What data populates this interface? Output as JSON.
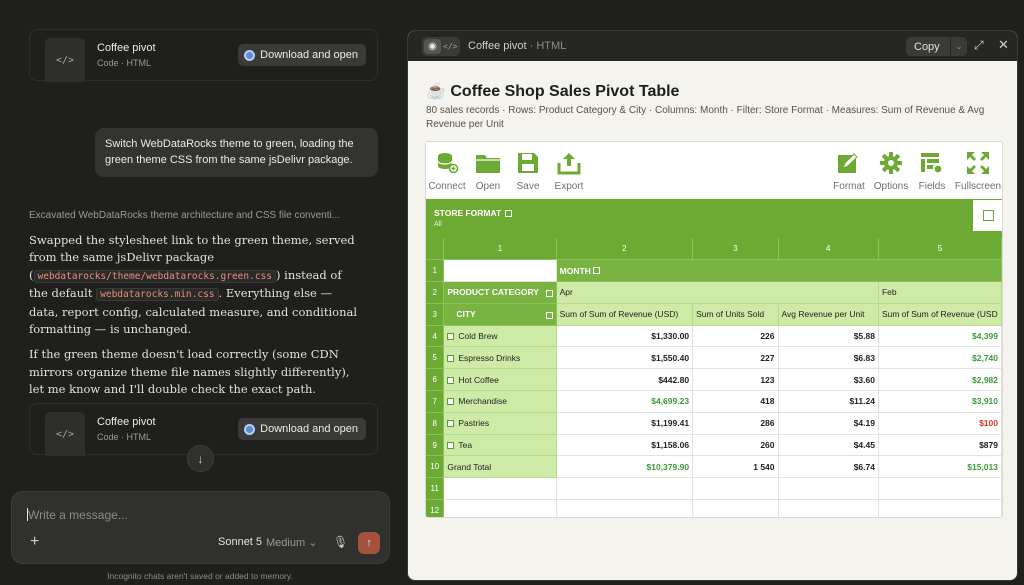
{
  "chat": {
    "top_card": {
      "title": "Coffee pivot",
      "subtitle": "Code · HTML",
      "download_label": "Download and open"
    },
    "user_message": "Switch WebDataRocks theme to green, loading the green theme CSS from the same jsDelivr package.",
    "thinking": "Excavated WebDataRocks theme architecture and CSS file conventi...",
    "reply_p1_a": "Swapped the stylesheet link to the green theme, served from the same jsDelivr package (",
    "reply_p1_code1": "webdatarocks/theme/webdatarocks.green.css",
    "reply_p1_b": ") instead of the default",
    "reply_p1_code2": "webdatarocks.min.css",
    "reply_p1_c": ". Everything else — data, report config, calculated measure, and conditional formatting — is unchanged.",
    "reply_p2": "If the green theme doesn't load correctly (some CDN mirrors organize theme file names slightly differently), let me know and I'll double check the exact path.",
    "bottom_card": {
      "title": "Coffee pivot",
      "subtitle": "Code · HTML",
      "download_label": "Download and open"
    },
    "composer_placeholder": "Write a message...",
    "model_name": "Sonnet 5",
    "model_mode": "Medium",
    "disclaimer": "Incognito chats aren't saved or added to memory."
  },
  "artifact": {
    "header_title": "Coffee pivot",
    "header_type": "HTML",
    "copy_label": "Copy",
    "doc_title": "☕ Coffee Shop Sales Pivot Table",
    "doc_subtitle": "80 sales records · Rows: Product Category & City · Columns: Month · Filter: Store Format · Measures: Sum of Revenue & Avg Revenue per Unit",
    "toolbar": {
      "connect": "Connect",
      "open": "Open",
      "save": "Save",
      "export": "Export",
      "format": "Format",
      "options": "Options",
      "fields": "Fields",
      "fullscreen": "Fullscreen"
    },
    "filter": {
      "label": "STORE FORMAT",
      "value": "All"
    },
    "col_numbers": [
      "1",
      "2",
      "3",
      "4",
      "5"
    ],
    "row_numbers": [
      "1",
      "2",
      "3",
      "4",
      "5",
      "6",
      "7",
      "8",
      "9",
      "10",
      "11",
      "12"
    ],
    "month_label": "MONTH",
    "product_category_label": "PRODUCT CATEGORY",
    "city_label": "CITY",
    "months": {
      "apr": "Apr",
      "feb": "Feb"
    },
    "measures": [
      "Sum of Sum of Revenue (USD)",
      "Sum of Units Sold",
      "Avg Revenue per Unit",
      "Sum of Sum of Revenue (USD"
    ],
    "rows": [
      {
        "label": "Cold Brew",
        "rev": "$1,330.00",
        "units": "226",
        "avg": "$5.88",
        "feb": "$4,399",
        "rev_color": "",
        "feb_color": "green"
      },
      {
        "label": "Espresso Drinks",
        "rev": "$1,550.40",
        "units": "227",
        "avg": "$6.83",
        "feb": "$2,740",
        "rev_color": "",
        "feb_color": "green"
      },
      {
        "label": "Hot Coffee",
        "rev": "$442.80",
        "units": "123",
        "avg": "$3.60",
        "feb": "$2,982",
        "rev_color": "",
        "feb_color": "green"
      },
      {
        "label": "Merchandise",
        "rev": "$4,699.23",
        "units": "418",
        "avg": "$11.24",
        "feb": "$3,910",
        "rev_color": "green",
        "feb_color": "green"
      },
      {
        "label": "Pastries",
        "rev": "$1,199.41",
        "units": "286",
        "avg": "$4.19",
        "feb": "$100",
        "rev_color": "",
        "feb_color": "red"
      },
      {
        "label": "Tea",
        "rev": "$1,158.06",
        "units": "260",
        "avg": "$4.45",
        "feb": "$879",
        "rev_color": "",
        "feb_color": ""
      }
    ],
    "grand_total": {
      "label": "Grand Total",
      "rev": "$10,379.90",
      "units": "1 540",
      "avg": "$6.74",
      "feb": "$15,013"
    }
  }
}
